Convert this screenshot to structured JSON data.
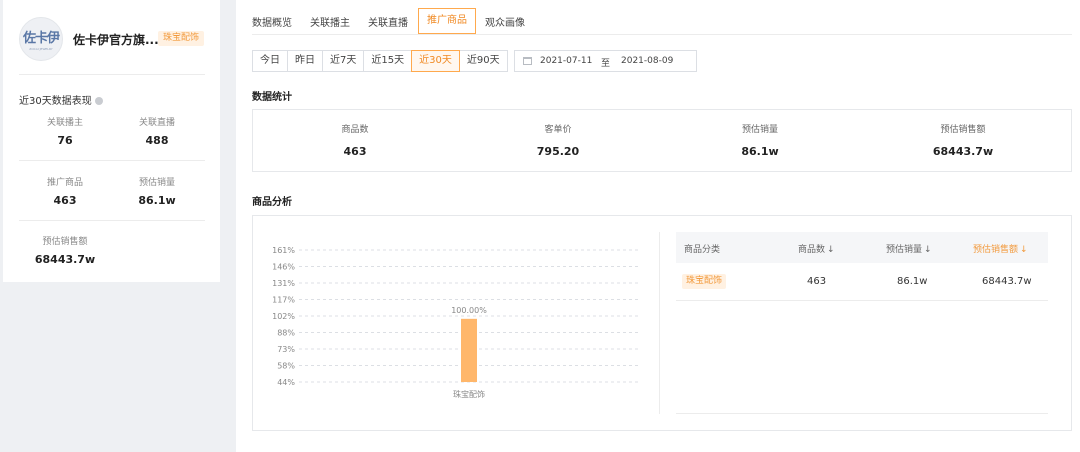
{
  "shop": {
    "logo_text": "佐卡伊",
    "logo_subtext": "ZOCAI JEWELRY",
    "name": "佐卡伊官方旗...",
    "tag": "珠宝配饰"
  },
  "performance": {
    "title": "近30天数据表现",
    "stats": [
      {
        "label": "关联播主",
        "value": "76"
      },
      {
        "label": "关联直播",
        "value": "488"
      },
      {
        "label": "推广商品",
        "value": "463"
      },
      {
        "label": "预估销量",
        "value": "86.1w"
      },
      {
        "label": "预估销售额",
        "value": "68443.7w"
      }
    ]
  },
  "tabs": [
    "数据概览",
    "关联播主",
    "关联直播",
    "推广商品",
    "观众画像"
  ],
  "active_tab": "推广商品",
  "ranges": [
    "今日",
    "昨日",
    "近7天",
    "近15天",
    "近30天",
    "近90天"
  ],
  "active_range": "近30天",
  "date_range": {
    "start": "2021-07-11",
    "separator": "至",
    "end": "2021-08-09"
  },
  "data_stats": {
    "title": "数据统计",
    "items": [
      {
        "label": "商品数",
        "value": "463"
      },
      {
        "label": "客单价",
        "value": "795.20"
      },
      {
        "label": "预估销量",
        "value": "86.1w"
      },
      {
        "label": "预估销售额",
        "value": "68443.7w"
      }
    ]
  },
  "analysis": {
    "title": "商品分析",
    "table": {
      "headers": [
        "商品分类",
        "商品数",
        "预估销量",
        "预估销售额"
      ],
      "sort_arrow": "↓",
      "rows": [
        {
          "category": "珠宝配饰",
          "count": "463",
          "sales": "86.1w",
          "revenue": "68443.7w"
        }
      ]
    }
  },
  "colors": {
    "accent": "#f08a24",
    "bar": "#ffb76b",
    "tag_bg": "#fff1e2"
  },
  "chart_data": {
    "type": "bar",
    "categories": [
      "珠宝配饰"
    ],
    "values": [
      100.0
    ],
    "data_labels": [
      "100.00%"
    ],
    "yticks": [
      "161%",
      "146%",
      "131%",
      "117%",
      "102%",
      "88%",
      "73%",
      "58%",
      "44%"
    ],
    "ylim": [
      44,
      161
    ],
    "grid": true
  }
}
